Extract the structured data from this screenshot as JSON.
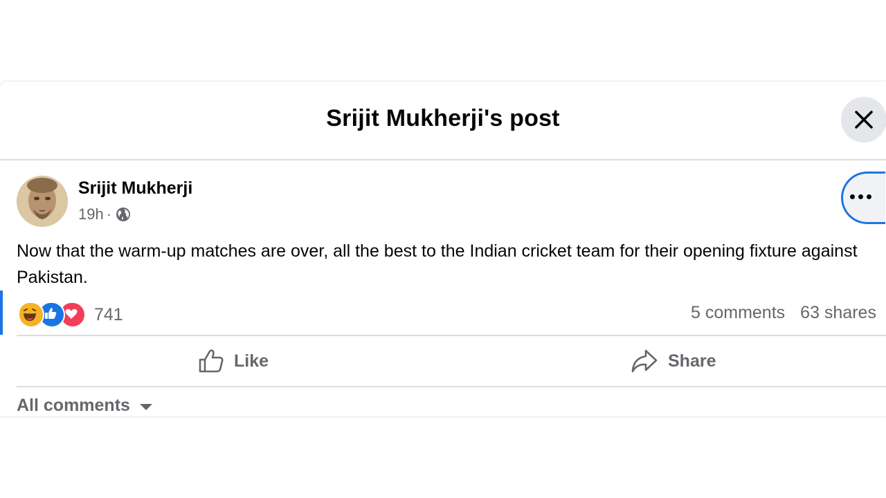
{
  "dialog": {
    "title": "Srijit Mukherji's post"
  },
  "post": {
    "author": "Srijit Mukherji",
    "time": "19h",
    "separator": "·",
    "privacy_icon": "globe-icon",
    "text": "Now that the warm-up matches are over, all the best to the Indian cricket team for their opening fixture against Pakistan."
  },
  "stats": {
    "reaction_icons": [
      "haha-icon",
      "like-icon",
      "love-icon"
    ],
    "reaction_count": "741",
    "comments": "5 comments",
    "shares": "63 shares"
  },
  "actions": {
    "like_label": "Like",
    "share_label": "Share"
  },
  "comments_filter": {
    "label": "All comments"
  },
  "colors": {
    "accent": "#1b74e4",
    "secondary_text": "#65676b",
    "divider": "#dadde1",
    "love": "#f33e58",
    "haha": "#f7b125"
  }
}
